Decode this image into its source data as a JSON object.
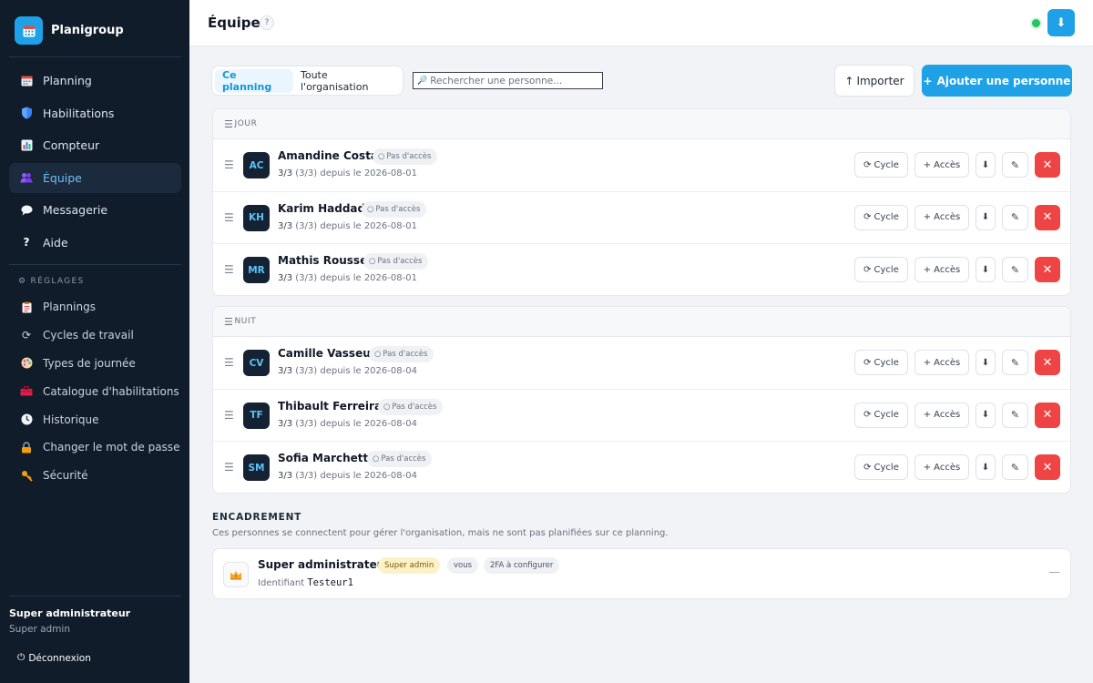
{
  "app": {
    "name": "Planigroup"
  },
  "sidebar": {
    "nav": [
      {
        "label": "Planning",
        "icon": "calendar-icon",
        "active": false
      },
      {
        "label": "Habilitations",
        "icon": "shield-icon",
        "active": false
      },
      {
        "label": "Compteur",
        "icon": "bar-chart-icon",
        "active": false
      },
      {
        "label": "Équipe",
        "icon": "team-icon",
        "active": true
      },
      {
        "label": "Messagerie",
        "icon": "chat-bubble-icon",
        "active": false
      },
      {
        "label": "Aide",
        "icon": "question-icon",
        "active": false
      }
    ],
    "settings_title": "RÉGLAGES",
    "settings": [
      {
        "label": "Plannings",
        "icon": "clipboard-icon"
      },
      {
        "label": "Cycles de travail",
        "icon": "cycle-icon"
      },
      {
        "label": "Types de journée",
        "icon": "palette-icon"
      },
      {
        "label": "Catalogue d'habilitations",
        "icon": "toolbox-icon"
      },
      {
        "label": "Historique",
        "icon": "clock-icon"
      },
      {
        "label": "Changer le mot de passe",
        "icon": "lock-icon"
      },
      {
        "label": "Sécurité",
        "icon": "key-icon"
      }
    ],
    "user": {
      "name": "Super administrateur",
      "role": "Super admin"
    },
    "logout_label": "Déconnexion"
  },
  "header": {
    "title": "Équipe",
    "help": "?"
  },
  "toolbar": {
    "tabs": [
      {
        "label": "Ce planning",
        "active": true
      },
      {
        "label": "Toute l'organisation",
        "active": false
      }
    ],
    "search_placeholder": "Rechercher une personne...",
    "import_label": "Importer",
    "add_label": "Ajouter une personne"
  },
  "row_labels": {
    "no_access": "Pas d'accès",
    "cycle": "Cycle",
    "access": "Accès"
  },
  "groups": [
    {
      "label": "JOUR",
      "people": [
        {
          "initials": "AC",
          "name": "Amandine Costa",
          "ratio": "3/3",
          "meta": "(3/3) depuis le 2026-08-01"
        },
        {
          "initials": "KH",
          "name": "Karim Haddad",
          "ratio": "3/3",
          "meta": "(3/3) depuis le 2026-08-01"
        },
        {
          "initials": "MR",
          "name": "Mathis Roussel",
          "ratio": "3/3",
          "meta": "(3/3) depuis le 2026-08-01"
        }
      ]
    },
    {
      "label": "NUIT",
      "people": [
        {
          "initials": "CV",
          "name": "Camille Vasseur",
          "ratio": "3/3",
          "meta": "(3/3) depuis le 2026-08-04"
        },
        {
          "initials": "TF",
          "name": "Thibault Ferreira",
          "ratio": "3/3",
          "meta": "(3/3) depuis le 2026-08-04"
        },
        {
          "initials": "SM",
          "name": "Sofia Marchetti",
          "ratio": "3/3",
          "meta": "(3/3) depuis le 2026-08-04"
        }
      ]
    }
  ],
  "encadrement": {
    "title": "ENCADREMENT",
    "subtitle": "Ces personnes se connectent pour gérer l'organisation, mais ne sont pas planifiées sur ce planning.",
    "person": {
      "name": "Super administrateur",
      "badge_role": "Super admin",
      "badge_you": "vous",
      "badge_2fa": "2FA à configurer",
      "id_label": "Identifiant",
      "id_value": "Testeur1"
    }
  },
  "colors": {
    "accent": "#1ea1e6",
    "sidebar_bg": "#111c2b",
    "danger": "#ef4444",
    "online": "#22c55e"
  }
}
